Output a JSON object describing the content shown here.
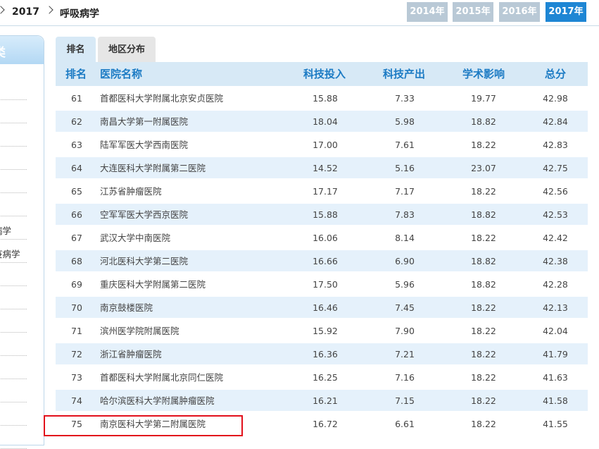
{
  "breadcrumb": {
    "year": "2017",
    "section": "呼吸病学"
  },
  "years": [
    {
      "label": "2014年",
      "active": false
    },
    {
      "label": "2015年",
      "active": false
    },
    {
      "label": "2016年",
      "active": false
    },
    {
      "label": "2017年",
      "active": true
    }
  ],
  "sidebar": {
    "heading": "类",
    "items": [
      "",
      "",
      "",
      "",
      "",
      "",
      "病学",
      "疫病学",
      "",
      "",
      "",
      "",
      "",
      "",
      "",
      ""
    ]
  },
  "tabs": [
    {
      "label": "排名",
      "active": true
    },
    {
      "label": "地区分布",
      "active": false
    }
  ],
  "table": {
    "headers": {
      "rank": "排名",
      "name": "医院名称",
      "tech_input": "科技投入",
      "tech_output": "科技产出",
      "academic": "学术影响",
      "total": "总分"
    },
    "rows": [
      {
        "rank": "61",
        "name": "首都医科大学附属北京安贞医院",
        "tech_input": "15.88",
        "tech_output": "7.33",
        "academic": "19.77",
        "total": "42.98"
      },
      {
        "rank": "62",
        "name": "南昌大学第一附属医院",
        "tech_input": "18.04",
        "tech_output": "5.98",
        "academic": "18.82",
        "total": "42.84"
      },
      {
        "rank": "63",
        "name": "陆军军医大学西南医院",
        "tech_input": "17.00",
        "tech_output": "7.61",
        "academic": "18.22",
        "total": "42.83"
      },
      {
        "rank": "64",
        "name": "大连医科大学附属第二医院",
        "tech_input": "14.52",
        "tech_output": "5.16",
        "academic": "23.07",
        "total": "42.75"
      },
      {
        "rank": "65",
        "name": "江苏省肿瘤医院",
        "tech_input": "17.17",
        "tech_output": "7.17",
        "academic": "18.22",
        "total": "42.56"
      },
      {
        "rank": "66",
        "name": "空军军医大学西京医院",
        "tech_input": "15.88",
        "tech_output": "7.83",
        "academic": "18.82",
        "total": "42.53"
      },
      {
        "rank": "67",
        "name": "武汉大学中南医院",
        "tech_input": "16.06",
        "tech_output": "8.14",
        "academic": "18.22",
        "total": "42.42"
      },
      {
        "rank": "68",
        "name": "河北医科大学第二医院",
        "tech_input": "16.66",
        "tech_output": "6.90",
        "academic": "18.82",
        "total": "42.38"
      },
      {
        "rank": "69",
        "name": "重庆医科大学附属第二医院",
        "tech_input": "17.50",
        "tech_output": "5.96",
        "academic": "18.82",
        "total": "42.28"
      },
      {
        "rank": "70",
        "name": "南京鼓楼医院",
        "tech_input": "16.46",
        "tech_output": "7.45",
        "academic": "18.22",
        "total": "42.13"
      },
      {
        "rank": "71",
        "name": "滨州医学院附属医院",
        "tech_input": "15.92",
        "tech_output": "7.90",
        "academic": "18.22",
        "total": "42.04"
      },
      {
        "rank": "72",
        "name": "浙江省肿瘤医院",
        "tech_input": "16.36",
        "tech_output": "7.21",
        "academic": "18.22",
        "total": "41.79"
      },
      {
        "rank": "73",
        "name": "首都医科大学附属北京同仁医院",
        "tech_input": "16.25",
        "tech_output": "7.16",
        "academic": "18.22",
        "total": "41.63"
      },
      {
        "rank": "74",
        "name": "哈尔滨医科大学附属肿瘤医院",
        "tech_input": "16.21",
        "tech_output": "7.15",
        "academic": "18.22",
        "total": "41.58"
      },
      {
        "rank": "75",
        "name": "南京医科大学第二附属医院",
        "tech_input": "16.72",
        "tech_output": "6.61",
        "academic": "18.22",
        "total": "41.55"
      }
    ]
  },
  "colors": {
    "accent": "#1e86d4",
    "header_text": "#1c7bc4",
    "highlight_border": "#e2101b",
    "row_alt": "#e5f1fb"
  }
}
